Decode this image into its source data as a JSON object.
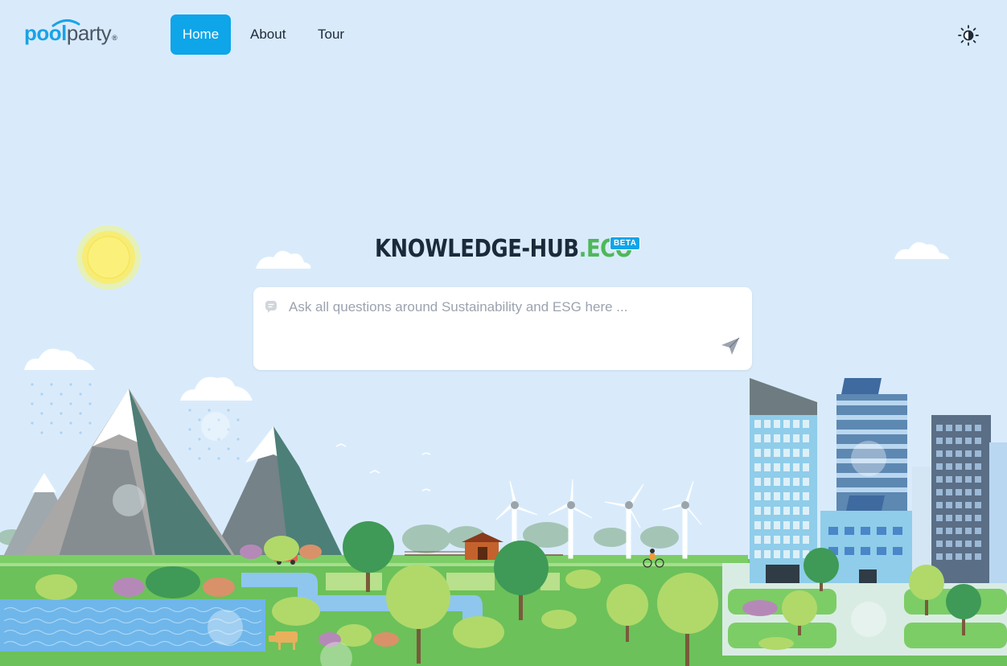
{
  "app": {
    "logo_pool": "pool",
    "logo_party": "party",
    "logo_reg": "®"
  },
  "nav": {
    "items": [
      {
        "label": "Home",
        "active": true
      },
      {
        "label": "About",
        "active": false
      },
      {
        "label": "Tour",
        "active": false
      }
    ],
    "theme_toggle_icon": "sun-icon"
  },
  "hero": {
    "title_main": "KNOWLEDGE-HUB",
    "title_suffix": ".ECO",
    "badge": "BETA"
  },
  "search": {
    "placeholder": "Ask all questions around Sustainability and ESG here ...",
    "value": "",
    "leading_icon": "chat-bubble-icon",
    "submit_icon": "send-icon"
  },
  "colors": {
    "sky": "#d9ebfb",
    "accent": "#0ea5e9",
    "eco_green": "#4fb85a",
    "title_dark": "#1b2a3a",
    "ground_green": "#6cc15a",
    "water": "#6fb6ea"
  }
}
